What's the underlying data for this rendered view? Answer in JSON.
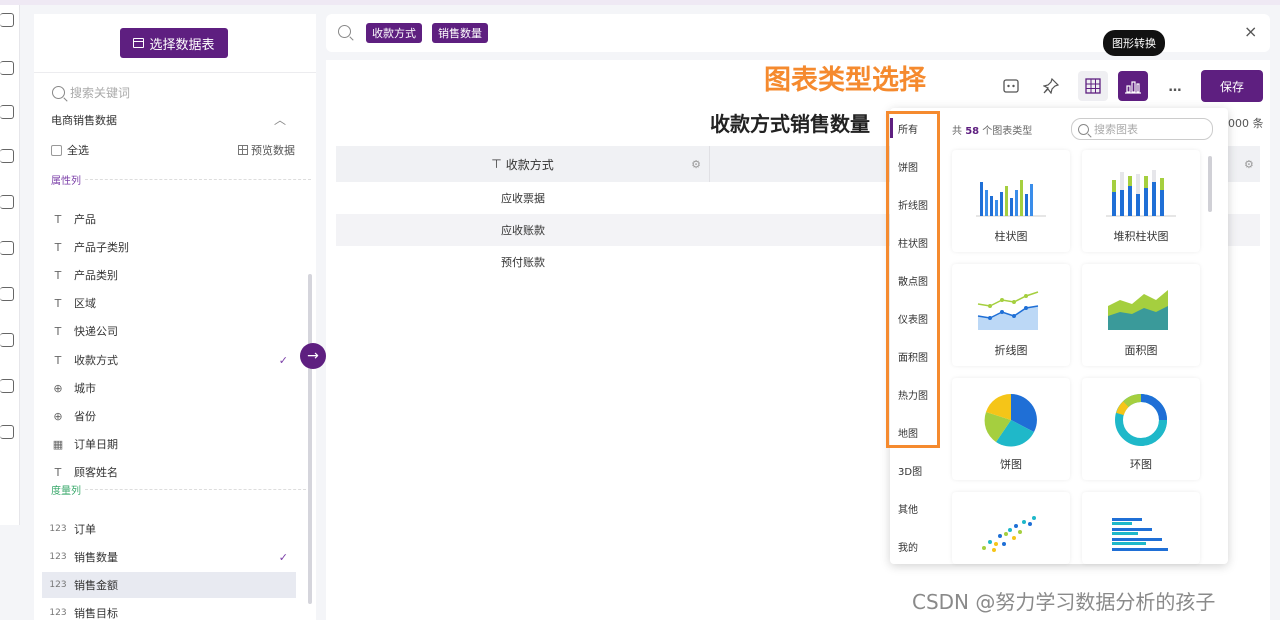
{
  "sidebar": {
    "select_table_label": "选择数据表",
    "search_placeholder": "搜索关键词",
    "dataset_name": "电商销售数据",
    "select_all_label": "全选",
    "preview_label": "预览数据",
    "attr_group_label": "属性列",
    "measure_group_label": "度量列",
    "attr_fields": [
      {
        "name": "产品",
        "type": "T"
      },
      {
        "name": "产品子类别",
        "type": "T"
      },
      {
        "name": "产品类别",
        "type": "T"
      },
      {
        "name": "区域",
        "type": "T"
      },
      {
        "name": "快递公司",
        "type": "T"
      },
      {
        "name": "收款方式",
        "type": "T"
      },
      {
        "name": "城市",
        "type": "⊕"
      },
      {
        "name": "省份",
        "type": "⊕"
      },
      {
        "name": "订单日期",
        "type": "▦"
      },
      {
        "name": "顾客姓名",
        "type": "T"
      }
    ],
    "measure_fields": [
      {
        "name": "订单",
        "type": "123"
      },
      {
        "name": "销售数量",
        "type": "123"
      },
      {
        "name": "销售金额",
        "type": "123"
      },
      {
        "name": "销售目标",
        "type": "123"
      }
    ],
    "check_mark": "✓"
  },
  "query": {
    "pills": [
      "收款方式",
      "销售数量"
    ],
    "close": "×"
  },
  "toolbar": {
    "more": "…",
    "save_label": "保存",
    "tooltip": "图形转换"
  },
  "annotation": "图表类型选择",
  "chart": {
    "title": "收款方式销售数量",
    "count_text": "000 条",
    "column_header": "收款方式",
    "rows": [
      "应收票据",
      "应收账款",
      "预付账款"
    ]
  },
  "picker": {
    "categories": [
      "所有",
      "饼图",
      "折线图",
      "柱状图",
      "散点图",
      "仪表图",
      "面积图",
      "热力图",
      "地图",
      "3D图",
      "其他",
      "我的"
    ],
    "count_prefix": "共",
    "count_number": "58",
    "count_suffix": "个图表类型",
    "search_placeholder": "搜索图表",
    "types": [
      "柱状图",
      "堆积柱状图",
      "折线图",
      "面积图",
      "饼图",
      "环图"
    ]
  },
  "watermark": "CSDN @努力学习数据分析的孩子",
  "colors": {
    "brand_purple": "#5e1f80",
    "annotation_orange": "#f58a2e",
    "measure_green": "#3aa86b"
  }
}
